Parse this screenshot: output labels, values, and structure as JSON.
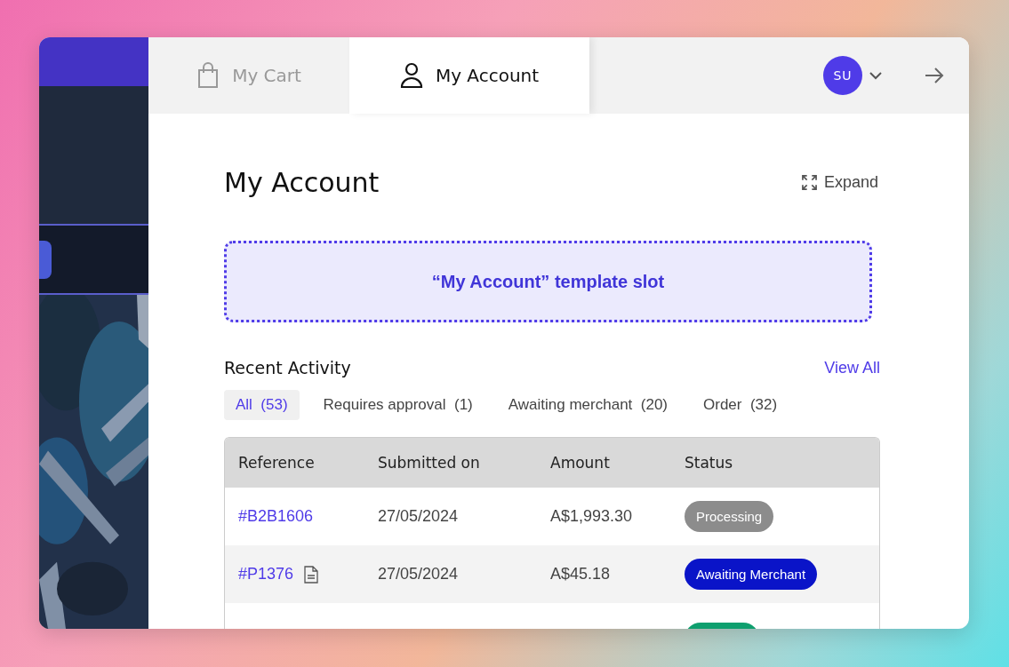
{
  "tabs": [
    {
      "label": "My Cart",
      "selected": false
    },
    {
      "label": "My Account",
      "selected": true
    }
  ],
  "user": {
    "initials": "SU"
  },
  "page": {
    "title": "My Account",
    "expand": "Expand"
  },
  "slot": {
    "text": "“My Account” template slot"
  },
  "activity": {
    "title": "Recent Activity",
    "view_all": "View All",
    "filters": [
      {
        "label": "All",
        "count": "(53)",
        "selected": true
      },
      {
        "label": "Requires approval",
        "count": "(1)",
        "selected": false
      },
      {
        "label": "Awaiting merchant",
        "count": "(20)",
        "selected": false
      },
      {
        "label": "Order",
        "count": "(32)",
        "selected": false
      }
    ],
    "table": {
      "columns": [
        "Reference",
        "Submitted on",
        "Amount",
        "Status"
      ],
      "rows": [
        {
          "reference": "#B2B1606",
          "document": false,
          "submitted": "27/05/2024",
          "amount": "A$1,993.30",
          "status": "Processing",
          "color": "#8c8c8c"
        },
        {
          "reference": "#P1376",
          "document": true,
          "submitted": "27/05/2024",
          "amount": "A$45.18",
          "status": "Awaiting Merchant",
          "color": "#0a14c8"
        },
        {
          "color": "#0e9f6e"
        }
      ]
    }
  }
}
